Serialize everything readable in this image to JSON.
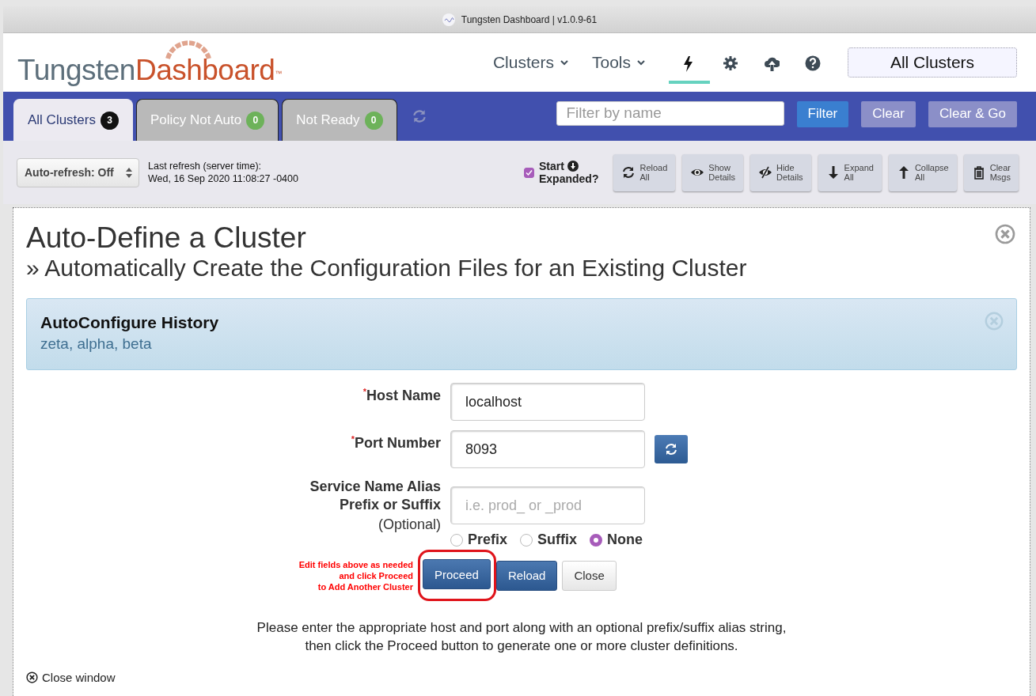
{
  "window": {
    "title": "Tungsten Dashboard | v1.0.9-61"
  },
  "logo": {
    "part_1": "Tungsten",
    "part_2": "Dashboard",
    "mark": "™"
  },
  "nav": {
    "menus": [
      {
        "label": "Clusters"
      },
      {
        "label": "Tools"
      }
    ],
    "icons": [
      {
        "kind": "bolt",
        "selected": true
      },
      {
        "kind": "gear",
        "selected": false
      },
      {
        "kind": "cloud",
        "selected": false
      },
      {
        "kind": "help",
        "selected": false
      }
    ],
    "cluster_button": "All Clusters"
  },
  "tabs": [
    {
      "label": "All Clusters",
      "count": "3",
      "selected": true
    },
    {
      "label": "Policy Not Auto",
      "count": "0",
      "selected": false
    },
    {
      "label": "Not Ready",
      "count": "0",
      "selected": false
    }
  ],
  "filter": {
    "placeholder": "Filter by name",
    "buttons": [
      {
        "label": "Filter",
        "kind": "primary"
      },
      {
        "label": "Clear",
        "kind": "muted"
      },
      {
        "label": "Clear & Go",
        "kind": "muted"
      }
    ]
  },
  "toolbar": {
    "auto_refresh": "Auto-refresh: Off",
    "refresh_label": "Last refresh (server time):",
    "refresh_time": "Wed, 16 Sep 2020 11:08:27 -0400",
    "start_expanded": {
      "line_1": "Start",
      "line_2": "Expanded?",
      "checked": true
    },
    "buttons": [
      {
        "kind": "reload",
        "line_1": "Reload",
        "line_2": "All"
      },
      {
        "kind": "show",
        "line_1": "Show",
        "line_2": "Details"
      },
      {
        "kind": "hide",
        "line_1": "Hide",
        "line_2": "Details"
      },
      {
        "kind": "expand",
        "line_1": "Expand",
        "line_2": "All"
      },
      {
        "kind": "collapse",
        "line_1": "Collapse",
        "line_2": "All"
      },
      {
        "kind": "clear",
        "line_1": "Clear",
        "line_2": "Msgs"
      }
    ]
  },
  "dialog": {
    "title": "Auto-Define a Cluster",
    "subtitle": "» Automatically Create the Configuration Files for an Existing Cluster",
    "history": {
      "title": "AutoConfigure History",
      "names": "zeta, alpha, beta"
    },
    "fields": [
      {
        "label": "Host Name",
        "required_mark": "*",
        "value": "localhost"
      },
      {
        "label": "Port Number",
        "required_mark": "*",
        "value": "8093",
        "refresh": true
      },
      {
        "label": "Service Name Alias\nPrefix or Suffix",
        "note": "(Optional)",
        "placeholder": "i.e. prod_ or _prod"
      }
    ],
    "alias_options": [
      {
        "label": "Prefix",
        "selected": false
      },
      {
        "label": "Suffix",
        "selected": false
      },
      {
        "label": "None",
        "selected": true
      }
    ],
    "hint": "Edit fields above as needed\nand click Proceed\nto Add Another Cluster",
    "buttons": [
      {
        "label": "Proceed",
        "kind": "primary",
        "highlighted": true
      },
      {
        "label": "Reload",
        "kind": "primary",
        "highlighted": false
      },
      {
        "label": "Close",
        "kind": "default",
        "highlighted": false
      }
    ],
    "instructions": "Please enter the appropriate host and port along with an optional prefix/suffix alias string,\nthen click the Proceed button to generate one or more cluster definitions.",
    "close_link": "Close window"
  }
}
